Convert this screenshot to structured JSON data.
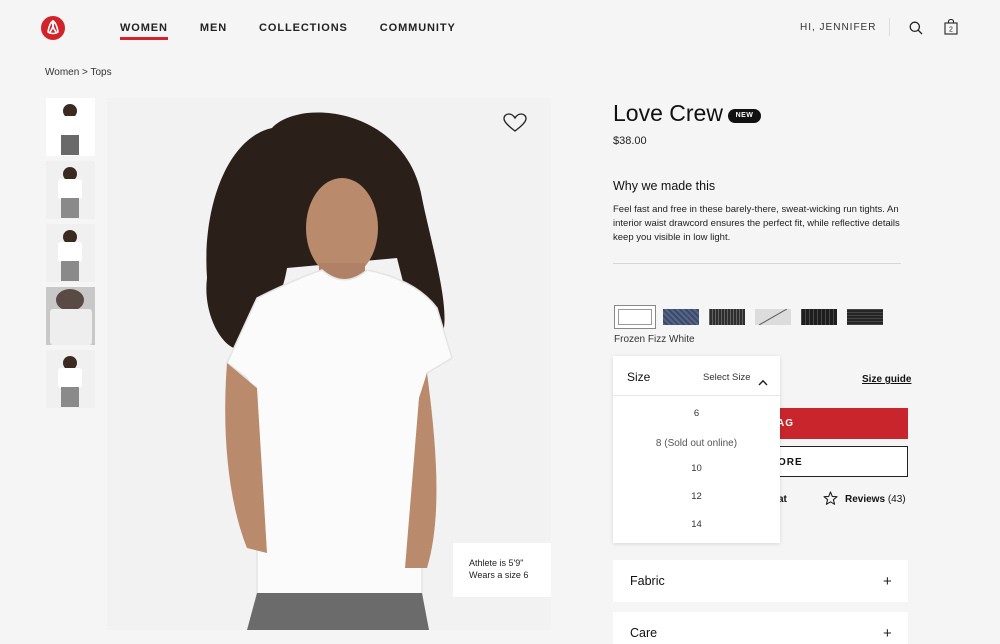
{
  "header": {
    "logo": "lululemon-logo",
    "nav": [
      {
        "label": "WOMEN",
        "active": true
      },
      {
        "label": "MEN",
        "active": false
      },
      {
        "label": "COLLECTIONS",
        "active": false
      },
      {
        "label": "COMMUNITY",
        "active": false
      }
    ],
    "greeting": "HI, JENNIFER",
    "bag_count": "2"
  },
  "breadcrumb": "Women > Tops",
  "gallery": {
    "thumbnails": [
      "front-view",
      "full-body-view",
      "side-view",
      "closeup-view",
      "back-view"
    ],
    "athlete_line1": "Athlete is 5'9\"",
    "athlete_line2": "Wears a size 6"
  },
  "product": {
    "title": "Love Crew",
    "badge": "NEW",
    "price": "$38.00",
    "why_title": "Why we made this",
    "why_desc": "Feel fast and free in these barely-there, sweat-wicking run tights. An interior waist drawcord ensures the perfect fit, while reflective details keep you visible in low light.",
    "color_name": "Frozen Fizz White",
    "swatches": [
      {
        "name": "white",
        "color": "#ffffff"
      },
      {
        "name": "navy-heather",
        "color": "#3a4a6e"
      },
      {
        "name": "grey-heather",
        "color": "#4a4a4a"
      },
      {
        "name": "sold-out-light-grey",
        "color": "#dcdcdc"
      },
      {
        "name": "black-heather",
        "color": "#1e1e1e"
      },
      {
        "name": "black-heather-2",
        "color": "#252525"
      }
    ]
  },
  "size": {
    "label": "Size",
    "select_label": "Select Size",
    "guide_label": "Size guide",
    "options": [
      "6",
      "8  (Sold out online)",
      "10",
      "12",
      "14"
    ]
  },
  "actions": {
    "add_to_bag_fragment": "AG",
    "find_store_fragment": "ORE",
    "chat_fragment": "at",
    "reviews_label": "Reviews",
    "reviews_count": "(43)"
  },
  "accordions": [
    {
      "label": "Fabric"
    },
    {
      "label": "Care"
    }
  ],
  "colors": {
    "brand_red": "#d2232a",
    "button_red": "#c8252c"
  }
}
